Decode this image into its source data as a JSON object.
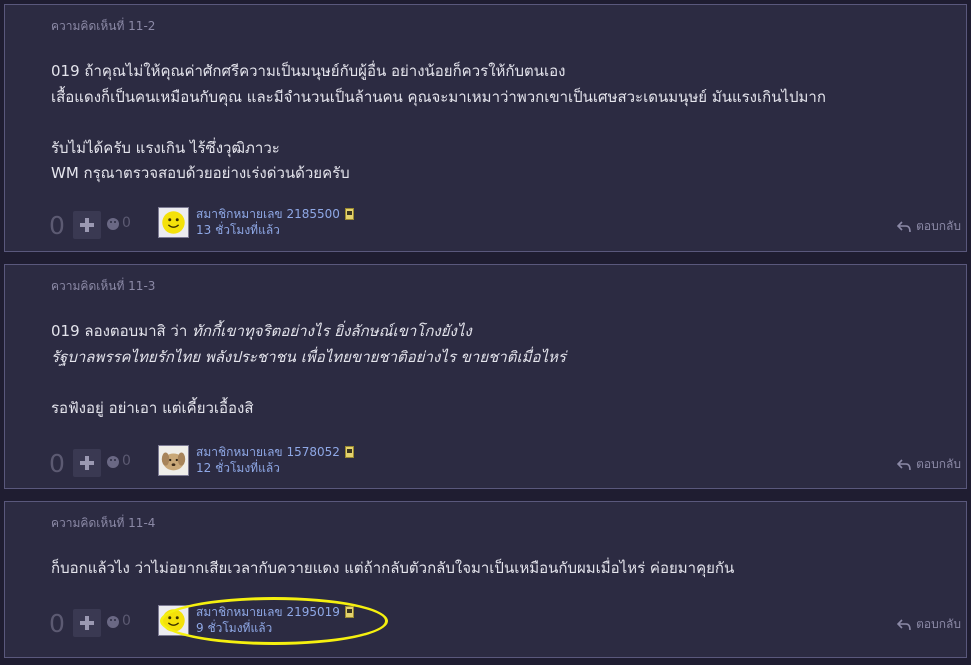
{
  "comments": [
    {
      "id_label": "ความคิดเห็นที่ 11-2",
      "lines": [
        "019 ถ้าคุณไม่ให้คุณค่าศักศรีความเป็นมนุษย์กับผู้อื่น อย่างน้อยก็ควรให้กับตนเอง",
        "เสื้อแดงก็เป็นคนเหมือนกับคุณ และมีจำนวนเป็นล้านคน คุณจะมาเหมาว่าพวกเขาเป็นเศษสวะเดนมนุษย์ มันแรงเกินไปมาก",
        "",
        "รับไม่ได้ครับ แรงเกิน ไร้ซึ่งวุฒิภาวะ",
        "WM กรุณาตรวจสอบด้วยอย่างเร่งด่วนด้วยครับ"
      ],
      "score": "0",
      "emote_count": "0",
      "member": "สมาชิกหมายเลข 2185500",
      "time": "13 ชั่วโมงที่แล้ว",
      "reply_label": "ตอบกลับ",
      "avatar_icon": "smiley-face-icon"
    },
    {
      "id_label": "ความคิดเห็นที่ 11-3",
      "lines_main": "019 ลองตอบมาสิ ว่า ",
      "lines_main_em": "ทักกี้เขาทุจริตอย่างไร ยิ่งลักษณ์เขาโกงยังไง",
      "line2_em": "รัฐบาลพรรคไทยรักไทย พลังประชาชน เพื่อไทยขายชาติอย่างไร ขายชาติเมื่อไหร่",
      "line4": "รอฟังอยู่ อย่าเอา แต่เคี้ยวเอื้องสิ",
      "score": "0",
      "emote_count": "0",
      "member": "สมาชิกหมายเลข 1578052",
      "time": "12 ชั่วโมงที่แล้ว",
      "reply_label": "ตอบกลับ",
      "avatar_icon": "dog-photo-icon"
    },
    {
      "id_label": "ความคิดเห็นที่ 11-4",
      "lines": [
        "ก็บอกแล้วไง ว่าไม่อยากเสียเวลากับควายแดง แต่ถ้ากลับตัวกลับใจมาเป็นเหมือนกับผมเมื่อไหร่ ค่อยมาคุยกัน"
      ],
      "score": "0",
      "emote_count": "0",
      "member": "สมาชิกหมายเลข 2195019",
      "time": "9 ชั่วโมงที่แล้ว",
      "reply_label": "ตอบกลับ",
      "avatar_icon": "smiley-face-icon"
    }
  ],
  "colors": {
    "page_bg": "#1f1d31",
    "card_bg": "#2c2b42",
    "text": "#e4e4ec",
    "link": "#8fa8e6",
    "muted": "#8b89a6",
    "highlight": "#f5f00f"
  }
}
